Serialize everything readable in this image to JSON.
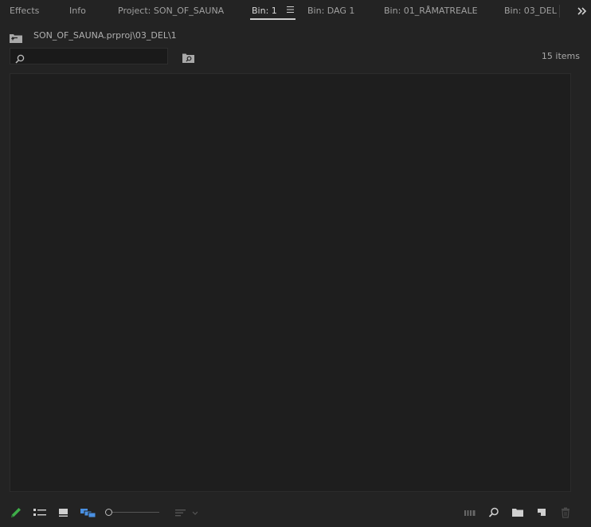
{
  "tabs": [
    {
      "label": "Effects",
      "active": false
    },
    {
      "label": "Info",
      "active": false
    },
    {
      "label": "Project: SON_OF_SAUNA",
      "active": false
    },
    {
      "label": "Bin: 1",
      "active": true
    },
    {
      "label": "Bin: DAG 1",
      "active": false
    },
    {
      "label": "Bin: 01_RÅMATREALE",
      "active": false
    },
    {
      "label": "Bin: 03_DEL",
      "active": false
    }
  ],
  "path": {
    "text": "SON_OF_SAUNA.prproj\\03_DEL\\1"
  },
  "search": {
    "value": "",
    "placeholder": ""
  },
  "items_count": "15 items",
  "icons": {
    "tab_menu": "hamburger-menu-icon",
    "overflow": "double-chevron-right-icon",
    "folder_up": "folder-up-icon",
    "search": "search-icon",
    "find": "find-icon",
    "pencil": "pencil-icon",
    "list_view": "list-view-icon",
    "icon_view": "icon-view-icon",
    "freeform_view": "freeform-view-icon",
    "sort": "sort-icon",
    "automate": "automate-to-sequence-icon",
    "find_bottom": "search-icon",
    "new_bin": "new-bin-icon",
    "new_item": "new-item-icon",
    "clear": "trash-icon"
  },
  "zoom_level": 0.0,
  "colors": {
    "background": "#232323",
    "content": "#1e1e1e",
    "accent_blue": "#4a90e2",
    "pencil_green": "#3fae49"
  }
}
